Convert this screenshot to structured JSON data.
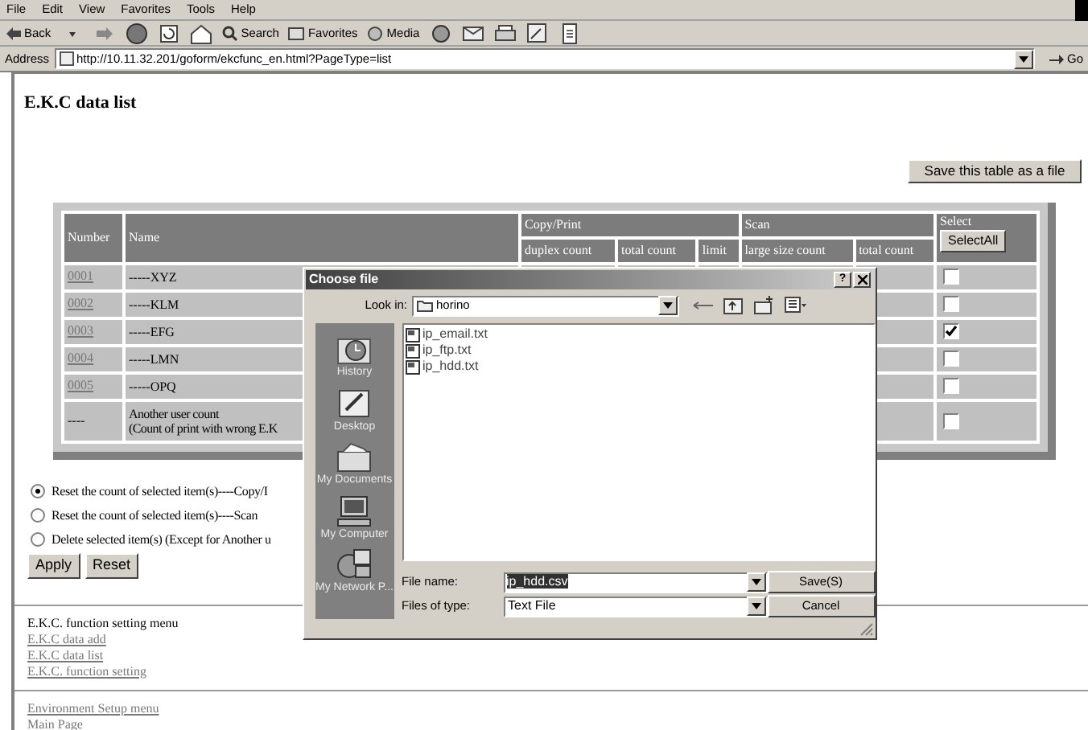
{
  "browser": {
    "menu": [
      "File",
      "Edit",
      "View",
      "Favorites",
      "Tools",
      "Help"
    ],
    "toolbar": {
      "back": "Back",
      "search": "Search",
      "favorites": "Favorites",
      "media": "Media"
    },
    "address_label": "Address",
    "url": "http://10.11.32.201/goform/ekcfunc_en.html?PageType=list",
    "go": "Go"
  },
  "page": {
    "title": "E.K.C data list",
    "save_button": "Save this table as a file",
    "table": {
      "number": "Number",
      "name": "Name",
      "copy_print": "Copy/Print",
      "scan": "Scan",
      "select": "Select",
      "select_all": "SelectAll",
      "sub_columns": [
        "duplex count",
        "total count",
        "limit",
        "large size count",
        "total count"
      ],
      "rows": [
        {
          "number": "0001",
          "name": "-----XYZ",
          "checked": false,
          "link": true
        },
        {
          "number": "0002",
          "name": "-----KLM",
          "checked": false,
          "link": true
        },
        {
          "number": "0003",
          "name": "-----EFG",
          "checked": true,
          "link": true
        },
        {
          "number": "0004",
          "name": "-----LMN",
          "checked": false,
          "link": true
        },
        {
          "number": "0005",
          "name": "-----OPQ",
          "checked": false,
          "link": true
        },
        {
          "number": "----",
          "name": "Another user count\n(Count of print with wrong E.K",
          "checked": false,
          "link": false
        }
      ]
    },
    "options": [
      {
        "label": "Reset the count of selected item(s)----Copy/I",
        "selected": true
      },
      {
        "label": "Reset the count of selected item(s)----Scan",
        "selected": false
      },
      {
        "label": "Delete selected item(s) (Except for Another u",
        "selected": false
      }
    ],
    "buttons": [
      "Apply",
      "Reset"
    ],
    "menu_heading": "E.K.C. function setting menu",
    "menu_links": [
      "E.K.C data add",
      "E.K.C data list",
      "E.K.C. function setting"
    ],
    "env_links": [
      "Environment Setup menu",
      "Main Page"
    ]
  },
  "dialog": {
    "title": "Choose file",
    "help": "?",
    "look_in_label": "Look in:",
    "look_in": "horino",
    "places": [
      {
        "label": "History",
        "kind": "history"
      },
      {
        "label": "Desktop",
        "kind": "desktop"
      },
      {
        "label": "My Documents",
        "kind": "documents"
      },
      {
        "label": "My Computer",
        "kind": "computer"
      },
      {
        "label": "My Network P...",
        "kind": "network"
      }
    ],
    "files": [
      "ip_email.txt",
      "ip_ftp.txt",
      "ip_hdd.txt"
    ],
    "file_name_label": "File name:",
    "file_name": "ip_hdd.csv",
    "file_type_label": "Files of type:",
    "file_type": "Text File",
    "save": "Save(S)",
    "cancel": "Cancel"
  }
}
